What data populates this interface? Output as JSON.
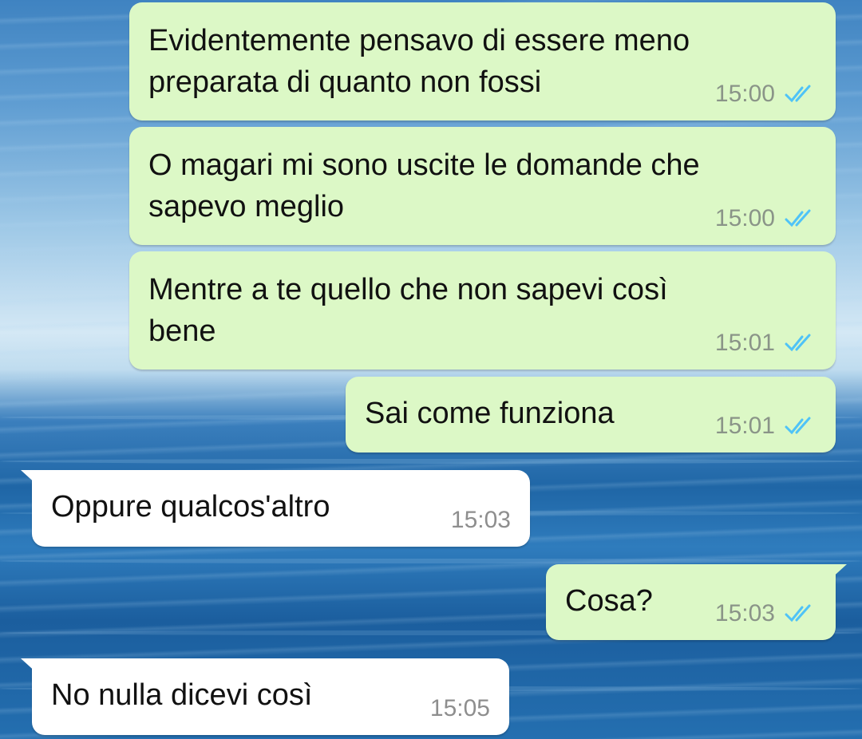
{
  "messages": [
    {
      "direction": "out",
      "text_lines": [
        "Evidentemente pensavo di essere meno",
        "preparata di quanto non fossi"
      ],
      "time": "15:00",
      "status": "read"
    },
    {
      "direction": "out",
      "text_lines": [
        "O magari mi sono uscite le domande che",
        "sapevo meglio"
      ],
      "time": "15:00",
      "status": "read"
    },
    {
      "direction": "out",
      "text_lines": [
        "Mentre a te quello che non sapevi così",
        "bene"
      ],
      "time": "15:01",
      "status": "read"
    },
    {
      "direction": "out",
      "text_lines": [
        "Sai come funziona"
      ],
      "time": "15:01",
      "status": "read"
    },
    {
      "direction": "in",
      "text_lines": [
        "Oppure qualcos'altro"
      ],
      "time": "15:03"
    },
    {
      "direction": "out",
      "text_lines": [
        "Cosa?"
      ],
      "time": "15:03",
      "status": "read"
    },
    {
      "direction": "in",
      "text_lines": [
        "No nulla dicevi così"
      ],
      "time": "15:05"
    }
  ],
  "colors": {
    "outgoing_bubble": "#dcf8c6",
    "incoming_bubble": "#ffffff",
    "read_tick": "#4fc3f7",
    "timestamp": "#8a9488"
  },
  "icons": {
    "read_receipt": "double-check-icon"
  }
}
